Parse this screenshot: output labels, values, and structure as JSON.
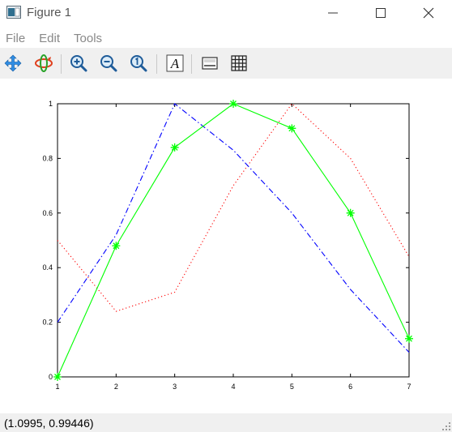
{
  "window": {
    "title": "Figure 1",
    "icons": {
      "app": "figure-icon",
      "minimize": "minimize-icon",
      "maximize": "maximize-icon",
      "close": "close-icon"
    }
  },
  "menu": {
    "items": [
      "File",
      "Edit",
      "Tools"
    ]
  },
  "toolbar": {
    "tools": [
      "pan-icon",
      "rotate-icon",
      "zoom-in-icon",
      "zoom-out-icon",
      "zoom-reset-icon",
      "text-icon",
      "legend-icon",
      "grid-icon"
    ]
  },
  "status": {
    "coordinates": "(1.0995, 0.99446)"
  },
  "chart_data": {
    "type": "line",
    "x": [
      1,
      2,
      3,
      4,
      5,
      6,
      7
    ],
    "xlim": [
      1,
      7
    ],
    "ylim": [
      0,
      1
    ],
    "xticks": [
      "1",
      "2",
      "3",
      "4",
      "5",
      "6",
      "7"
    ],
    "yticks": [
      "0",
      "0.2",
      "0.4",
      "0.6",
      "0.8",
      "1"
    ],
    "grid": false,
    "series": [
      {
        "values": [
          0.5,
          0.24,
          0.31,
          0.7,
          1.0,
          0.8,
          0.44
        ],
        "color": "#ff0000",
        "style": "dotted",
        "marker": "none"
      },
      {
        "values": [
          0.2,
          0.52,
          1.0,
          0.83,
          0.6,
          0.32,
          0.09
        ],
        "color": "#0000ff",
        "style": "dashdot",
        "marker": "none"
      },
      {
        "values": [
          0.0,
          0.48,
          0.84,
          1.0,
          0.91,
          0.6,
          0.14
        ],
        "color": "#00ff00",
        "style": "solid",
        "marker": "asterisk"
      }
    ]
  }
}
